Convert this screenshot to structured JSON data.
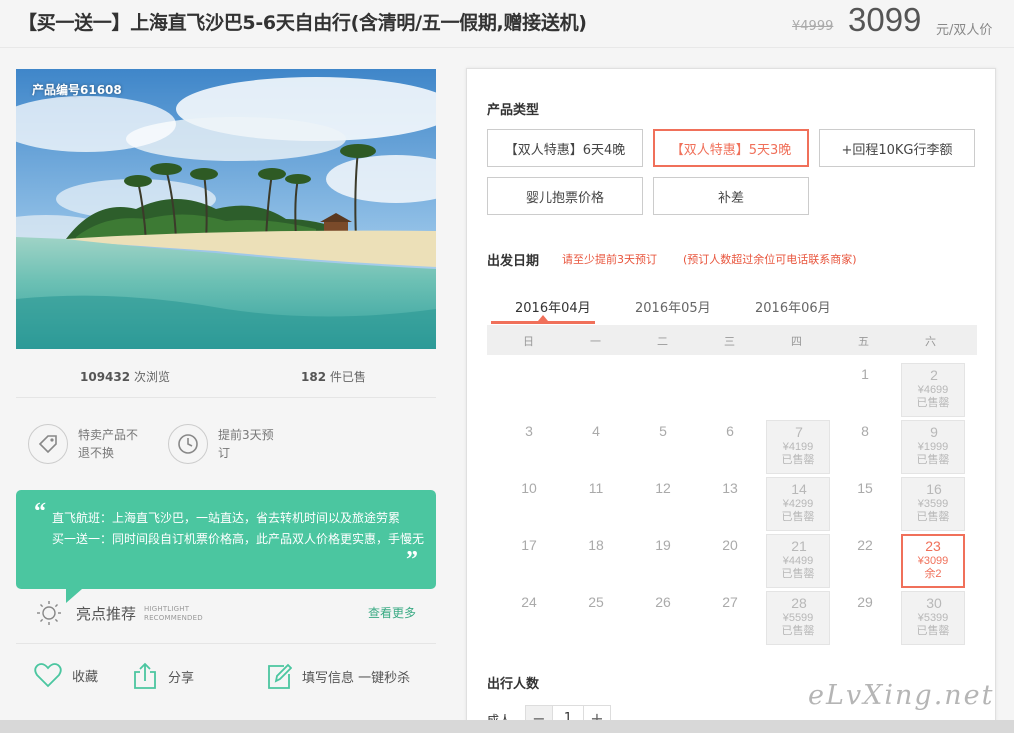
{
  "header": {
    "title": "【买一送一】上海直飞沙巴5-6天自由行(含清明/五一假期,赠接送机)",
    "old_price": "¥4999",
    "price": "3099",
    "price_unit": "元/双人价"
  },
  "product": {
    "code": "产品编号61608",
    "views_count": "109432",
    "views_label": "次浏览",
    "sold_count": "182",
    "sold_label": "件已售"
  },
  "policies": [
    {
      "icon": "tag-icon",
      "text": "特卖产品不退不换"
    },
    {
      "icon": "clock-icon",
      "text": "提前3天预订"
    }
  ],
  "highlight_bubble": {
    "line1": "直飞航班：上海直飞沙巴，一站直达，省去转机时间以及旅途劳累",
    "line2": "买一送一：同时间段自订机票价格高，此产品双人价格更实惠，手慢无"
  },
  "highlight": {
    "title": "亮点推荐",
    "en_line1": "HIGHTLIGHT",
    "en_line2": "RECOMMENDED",
    "more": "查看更多"
  },
  "actions": {
    "favorite": "收藏",
    "share": "分享",
    "fill_info": "填写信息 一键秒杀"
  },
  "booking": {
    "product_type_label": "产品类型",
    "product_types": [
      "【双人特惠】6天4晚",
      "【双人特惠】5天3晚",
      "+回程10KG行李额",
      "婴儿抱票价格",
      "补差"
    ],
    "selected_type_index": 1,
    "departure_label": "出发日期",
    "note1": "请至少提前3天预订",
    "note2": "(预订人数超过余位可电话联系商家)",
    "months": [
      "2016年04月",
      "2016年05月",
      "2016年06月"
    ],
    "active_month_index": 0,
    "weekdays": [
      "日",
      "一",
      "二",
      "三",
      "四",
      "五",
      "六"
    ],
    "days": [
      {
        "d": "1"
      },
      {
        "d": "2",
        "price": "¥4699",
        "status": "已售罄"
      },
      {
        "d": "3"
      },
      {
        "d": "4"
      },
      {
        "d": "5"
      },
      {
        "d": "6"
      },
      {
        "d": "7",
        "price": "¥4199",
        "status": "已售罄"
      },
      {
        "d": "8"
      },
      {
        "d": "9",
        "price": "¥1999",
        "status": "已售罄"
      },
      {
        "d": "10"
      },
      {
        "d": "11"
      },
      {
        "d": "12"
      },
      {
        "d": "13"
      },
      {
        "d": "14",
        "price": "¥4299",
        "status": "已售罄"
      },
      {
        "d": "15"
      },
      {
        "d": "16",
        "price": "¥3599",
        "status": "已售罄"
      },
      {
        "d": "17"
      },
      {
        "d": "18"
      },
      {
        "d": "19"
      },
      {
        "d": "20"
      },
      {
        "d": "21",
        "price": "¥4499",
        "status": "已售罄"
      },
      {
        "d": "22"
      },
      {
        "d": "23",
        "price": "¥3099",
        "status": "余2",
        "available": true
      },
      {
        "d": "24"
      },
      {
        "d": "25"
      },
      {
        "d": "26"
      },
      {
        "d": "27"
      },
      {
        "d": "28",
        "price": "¥5599",
        "status": "已售罄"
      },
      {
        "d": "29"
      },
      {
        "d": "30",
        "price": "¥5399",
        "status": "已售罄"
      }
    ],
    "travelers_label": "出行人数",
    "adult_label": "成人",
    "adult_minus": "−",
    "adult_count": "1",
    "adult_plus": "+"
  },
  "watermark": "eLvXing.net",
  "colors": {
    "accent": "#f0705a",
    "teal": "#4bc6a0",
    "sold_out_bg": "#f2f2f2"
  }
}
